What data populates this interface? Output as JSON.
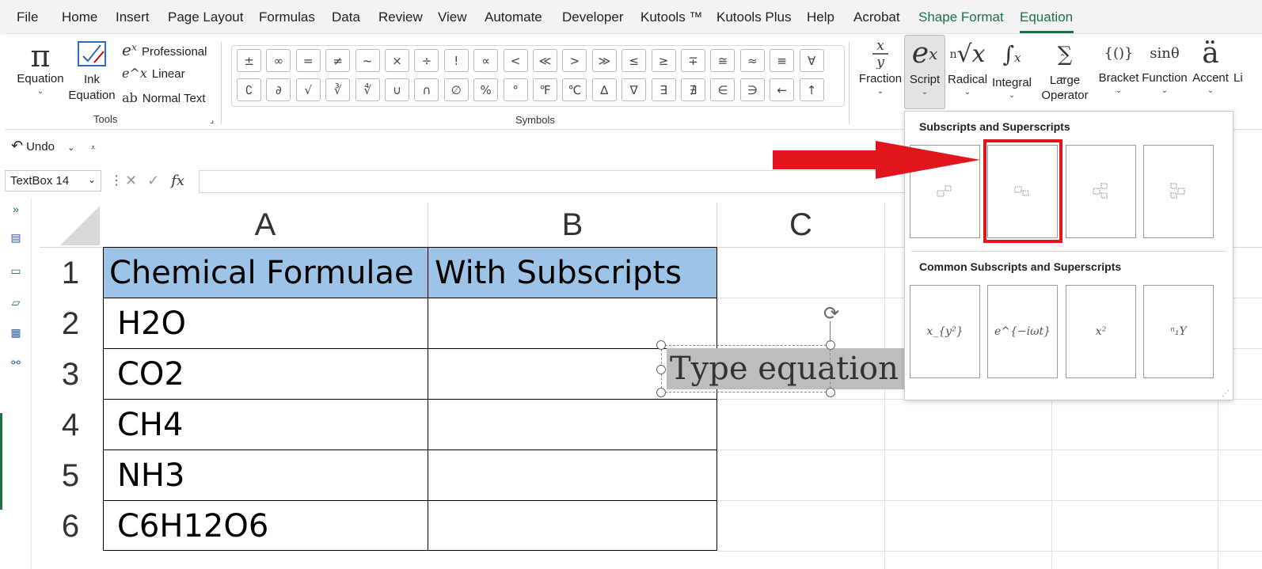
{
  "menu": {
    "tabs": [
      {
        "label": "File"
      },
      {
        "label": "Home"
      },
      {
        "label": "Insert"
      },
      {
        "label": "Page Layout"
      },
      {
        "label": "Formulas"
      },
      {
        "label": "Data"
      },
      {
        "label": "Review"
      },
      {
        "label": "View"
      },
      {
        "label": "Automate"
      },
      {
        "label": "Developer"
      },
      {
        "label": "Kutools ™"
      },
      {
        "label": "Kutools Plus"
      },
      {
        "label": "Help"
      },
      {
        "label": "Acrobat"
      },
      {
        "label": "Shape Format"
      },
      {
        "label": "Equation"
      }
    ]
  },
  "ribbon": {
    "tools": {
      "equation": "Equation",
      "ink": "Ink Equation",
      "professional": "Professional",
      "linear": "Linear",
      "normal_text": "Normal Text",
      "label": "Tools"
    },
    "symbols": {
      "label": "Symbols",
      "row1": [
        "±",
        "∞",
        "=",
        "≠",
        "~",
        "×",
        "÷",
        "!",
        "∝",
        "<",
        "≪",
        ">",
        "≫",
        "≤",
        "≥",
        "∓",
        "≅",
        "≈",
        "≡",
        "∀"
      ],
      "row2": [
        "∁",
        "∂",
        "√",
        "∛",
        "∜",
        "∪",
        "∩",
        "∅",
        "%",
        "°",
        "℉",
        "℃",
        "∆",
        "∇",
        "∃",
        "∄",
        "∈",
        "∋",
        "←",
        "↑"
      ]
    },
    "structures": [
      {
        "label": "Fraction",
        "glyph": "x/y"
      },
      {
        "label": "Script",
        "glyph": "eˣ"
      },
      {
        "label": "Radical",
        "glyph": "ⁿ√x"
      },
      {
        "label": "Integral",
        "glyph": "∫"
      },
      {
        "label": "Large Operator",
        "glyph": "Σ"
      },
      {
        "label": "Bracket",
        "glyph": "{()}"
      },
      {
        "label": "Function",
        "glyph": "sinθ"
      },
      {
        "label": "Accent",
        "glyph": "ä"
      },
      {
        "label": "Li",
        "glyph": ""
      }
    ]
  },
  "undo": {
    "label": "Undo"
  },
  "formula_bar": {
    "name_box": "TextBox 14",
    "fx": "fx"
  },
  "grid": {
    "columns": [
      "A",
      "B",
      "C"
    ],
    "rows": [
      "1",
      "2",
      "3",
      "4",
      "5",
      "6"
    ],
    "header_a": "Chemical Formulae",
    "header_b": "With Subscripts",
    "formulas": [
      "H2O",
      "CO2",
      "CH4",
      "NH3",
      "C6H12O6"
    ],
    "header_fill": "#9dc3e6"
  },
  "textbox": {
    "text": "Type equation"
  },
  "gallery": {
    "title1": "Subscripts and Superscripts",
    "title2": "Common Subscripts and Superscripts",
    "common": [
      "x_{y²}",
      "e^{−iωt}",
      "x²",
      "ⁿ₁Y"
    ]
  },
  "colors": {
    "accent": "#1e7145",
    "highlight": "#e0161c"
  }
}
